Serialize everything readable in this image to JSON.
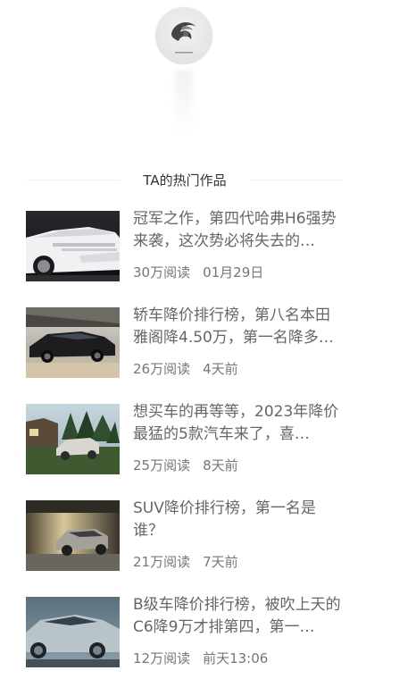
{
  "author": {
    "avatar_icon": "swirl-logo-icon"
  },
  "section": {
    "title": "TA的热门作品"
  },
  "articles": [
    {
      "title": "冠军之作，第四代哈弗H6强势来袭，这次势必将失去的…",
      "reads": "30万阅读",
      "time": "01月29日",
      "thumb": "white-suv"
    },
    {
      "title": "轿车降价排行榜，第八名本田雅阁降4.50万，第一名降多…",
      "reads": "26万阅读",
      "time": "4天前",
      "thumb": "black-sedan"
    },
    {
      "title": "想买车的再等等，2023年降价最猛的5款汽车来了，喜…",
      "reads": "25万阅读",
      "time": "8天前",
      "thumb": "suv-forest"
    },
    {
      "title": "SUV降价排行榜，第一名是谁？",
      "reads": "21万阅读",
      "time": "7天前",
      "thumb": "suv-garage"
    },
    {
      "title": "B级车降价排行榜，被吹上天的C6降9万才排第四，第一…",
      "reads": "12万阅读",
      "time": "前天13:06",
      "thumb": "silver-sedan"
    }
  ]
}
